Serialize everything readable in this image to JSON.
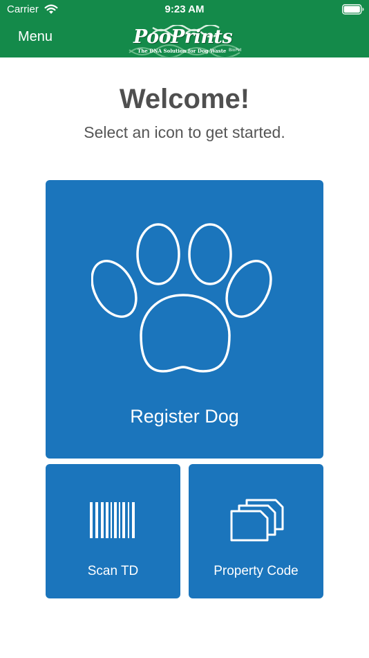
{
  "status_bar": {
    "carrier": "Carrier",
    "time": "9:23 AM"
  },
  "nav": {
    "menu_label": "Menu",
    "logo_text": "PooPrints",
    "logo_tagline": "The DNA Solution for Dog Waste"
  },
  "welcome": {
    "title": "Welcome!",
    "subtitle": "Select an icon to get started."
  },
  "tiles": {
    "register_dog": {
      "label": "Register Dog",
      "icon": "paw-icon"
    },
    "scan_td": {
      "label": "Scan TD",
      "icon": "barcode-icon"
    },
    "property_code": {
      "label": "Property Code",
      "icon": "folders-icon"
    }
  },
  "colors": {
    "header_green": "#148a4a",
    "tile_blue": "#1b75bc",
    "title_gray": "#4f4f4f"
  }
}
